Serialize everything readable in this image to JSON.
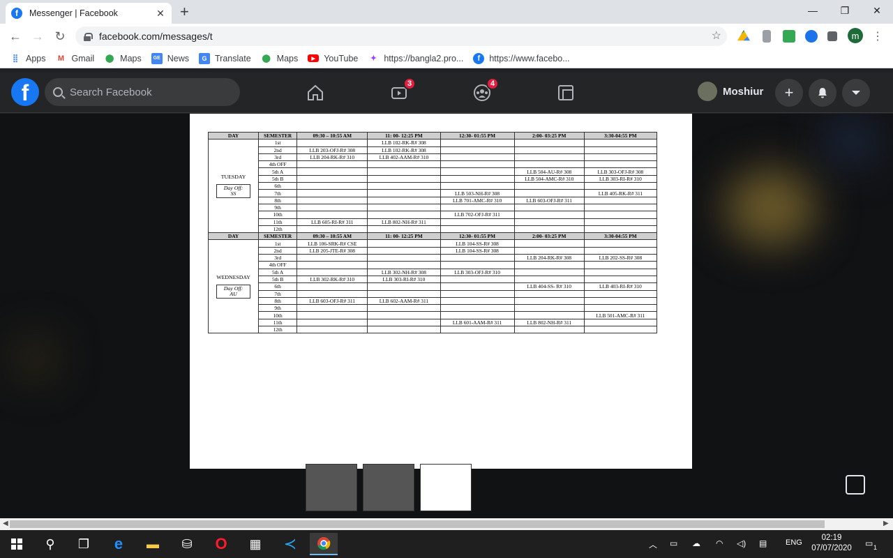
{
  "browser": {
    "tab_title": "Messenger | Facebook",
    "tab_close": "✕",
    "new_tab": "+",
    "window_controls": [
      "—",
      "❐",
      "✕"
    ],
    "url": "facebook.com/messages/t",
    "profile_initial": "m"
  },
  "bookmarks": [
    {
      "label": "Apps",
      "icon": "apps-grid-icon"
    },
    {
      "label": "Gmail",
      "icon": "gmail-icon"
    },
    {
      "label": "Maps",
      "icon": "maps-pin-icon"
    },
    {
      "label": "News",
      "icon": "news-icon"
    },
    {
      "label": "Translate",
      "icon": "translate-icon"
    },
    {
      "label": "Maps",
      "icon": "maps-pin-icon"
    },
    {
      "label": "YouTube",
      "icon": "youtube-icon"
    },
    {
      "label": "https://bangla2.pro...",
      "icon": "site-icon"
    },
    {
      "label": "https://www.facebo...",
      "icon": "facebook-icon"
    }
  ],
  "facebook": {
    "logo": "f",
    "search_placeholder": "Search Facebook",
    "watch_badge": "3",
    "groups_badge": "4",
    "user_name": "Moshiur",
    "plus": "+"
  },
  "schedule": {
    "headers": [
      "DAY",
      "SEMESTER",
      "09:30 – 10:55 AM",
      "11: 00- 12:25 PM",
      "12:30- 01:55 PM",
      "2:00- 03:25 PM",
      "3:30-04:55 PM"
    ],
    "headers2": [
      "DAY",
      "SEMESTER",
      "09:30 – 10:55 AM",
      "11: 00- 12:25 PM",
      "12:30- 01:55 PM",
      "2:00- 03:25 PM",
      "3:30-04:55 PM"
    ],
    "tuesday": {
      "day": "TUESDAY",
      "day_off": "Day Off:",
      "day_off_who": "SS",
      "rows": [
        [
          "1st",
          "",
          "LLB 102-RK-R# 308",
          "",
          "",
          ""
        ],
        [
          "2nd",
          "LLB 203-OFJ-R# 308",
          "LLB 102-RK-R# 308",
          "",
          "",
          ""
        ],
        [
          "3rd",
          "LLB 204-RK-R# 310",
          "LLB 402-AAM-R# 310",
          "",
          "",
          ""
        ],
        [
          "4th OFF",
          "",
          "",
          "",
          "",
          ""
        ],
        [
          "5th A",
          "",
          "",
          "",
          "LLB 504-AU-R# 308",
          "LLB 303-OFJ-R# 308"
        ],
        [
          "5th B",
          "",
          "",
          "",
          "LLB 504-AMC-R# 310",
          "LLB 303-RI-R# 310"
        ],
        [
          "6th",
          "",
          "",
          "",
          "",
          ""
        ],
        [
          "7th",
          "",
          "",
          "LLB 503-NH-R# 308",
          "",
          "LLB 405-RK-R# 311"
        ],
        [
          "8th",
          "",
          "",
          "LLB 701-AMC-R# 310",
          "LLB 603-OFJ-R# 311",
          ""
        ],
        [
          "9th",
          "",
          "",
          "",
          "",
          ""
        ],
        [
          "10th",
          "",
          "",
          "LLB 702-OFJ-R# 311",
          "",
          ""
        ],
        [
          "11th",
          "LLB 605-RI-R# 311",
          "LLB 802-NH-R# 311",
          "",
          "",
          ""
        ],
        [
          "12th",
          "",
          "",
          "",
          "",
          ""
        ]
      ]
    },
    "wednesday": {
      "day": "WEDNESDAY",
      "day_off": "Day Off:",
      "day_off_who": "AU",
      "rows": [
        [
          "1st",
          "LLB 106-SRK-R# CSE",
          "",
          "LLB 104-SS-R# 308",
          "",
          ""
        ],
        [
          "2nd",
          "LLB 205-JTE-R# 308",
          "",
          "LLB 104-SS-R# 308",
          "",
          ""
        ],
        [
          "3rd",
          "",
          "",
          "",
          "LLB 204-RK-R# 308",
          "LLB 202-SS-R# 308"
        ],
        [
          "4th OFF",
          "",
          "",
          "",
          "",
          ""
        ],
        [
          "5th A",
          "",
          "LLB 302-NH-R# 308",
          "LLB 303-OFJ-R# 310",
          "",
          ""
        ],
        [
          "5th B",
          "LLB 302-RK-R# 310",
          "LLB 303-RI-R# 310",
          "",
          "",
          ""
        ],
        [
          "6th",
          "",
          "",
          "",
          "LLB 404-SS- R# 310",
          "LLB 403-RI-R# 310"
        ],
        [
          "7th",
          "",
          "",
          "",
          "",
          ""
        ],
        [
          "8th",
          "LLB 603-OFJ-R# 311",
          "LLB 602-AAM-R# 311",
          "",
          "",
          ""
        ],
        [
          "9th",
          "",
          "",
          "",
          "",
          ""
        ],
        [
          "10th",
          "",
          "",
          "",
          "",
          "LLB 501-AMC-R# 311"
        ],
        [
          "11th",
          "",
          "",
          "LLB 601-AAM-R# 311",
          "LLB 802-NH-R# 311",
          ""
        ],
        [
          "12th",
          "",
          "",
          "",
          "",
          ""
        ]
      ]
    }
  },
  "taskbar": {
    "lang": "ENG",
    "time": "02:19",
    "date": "07/07/2020",
    "notif": "1"
  }
}
